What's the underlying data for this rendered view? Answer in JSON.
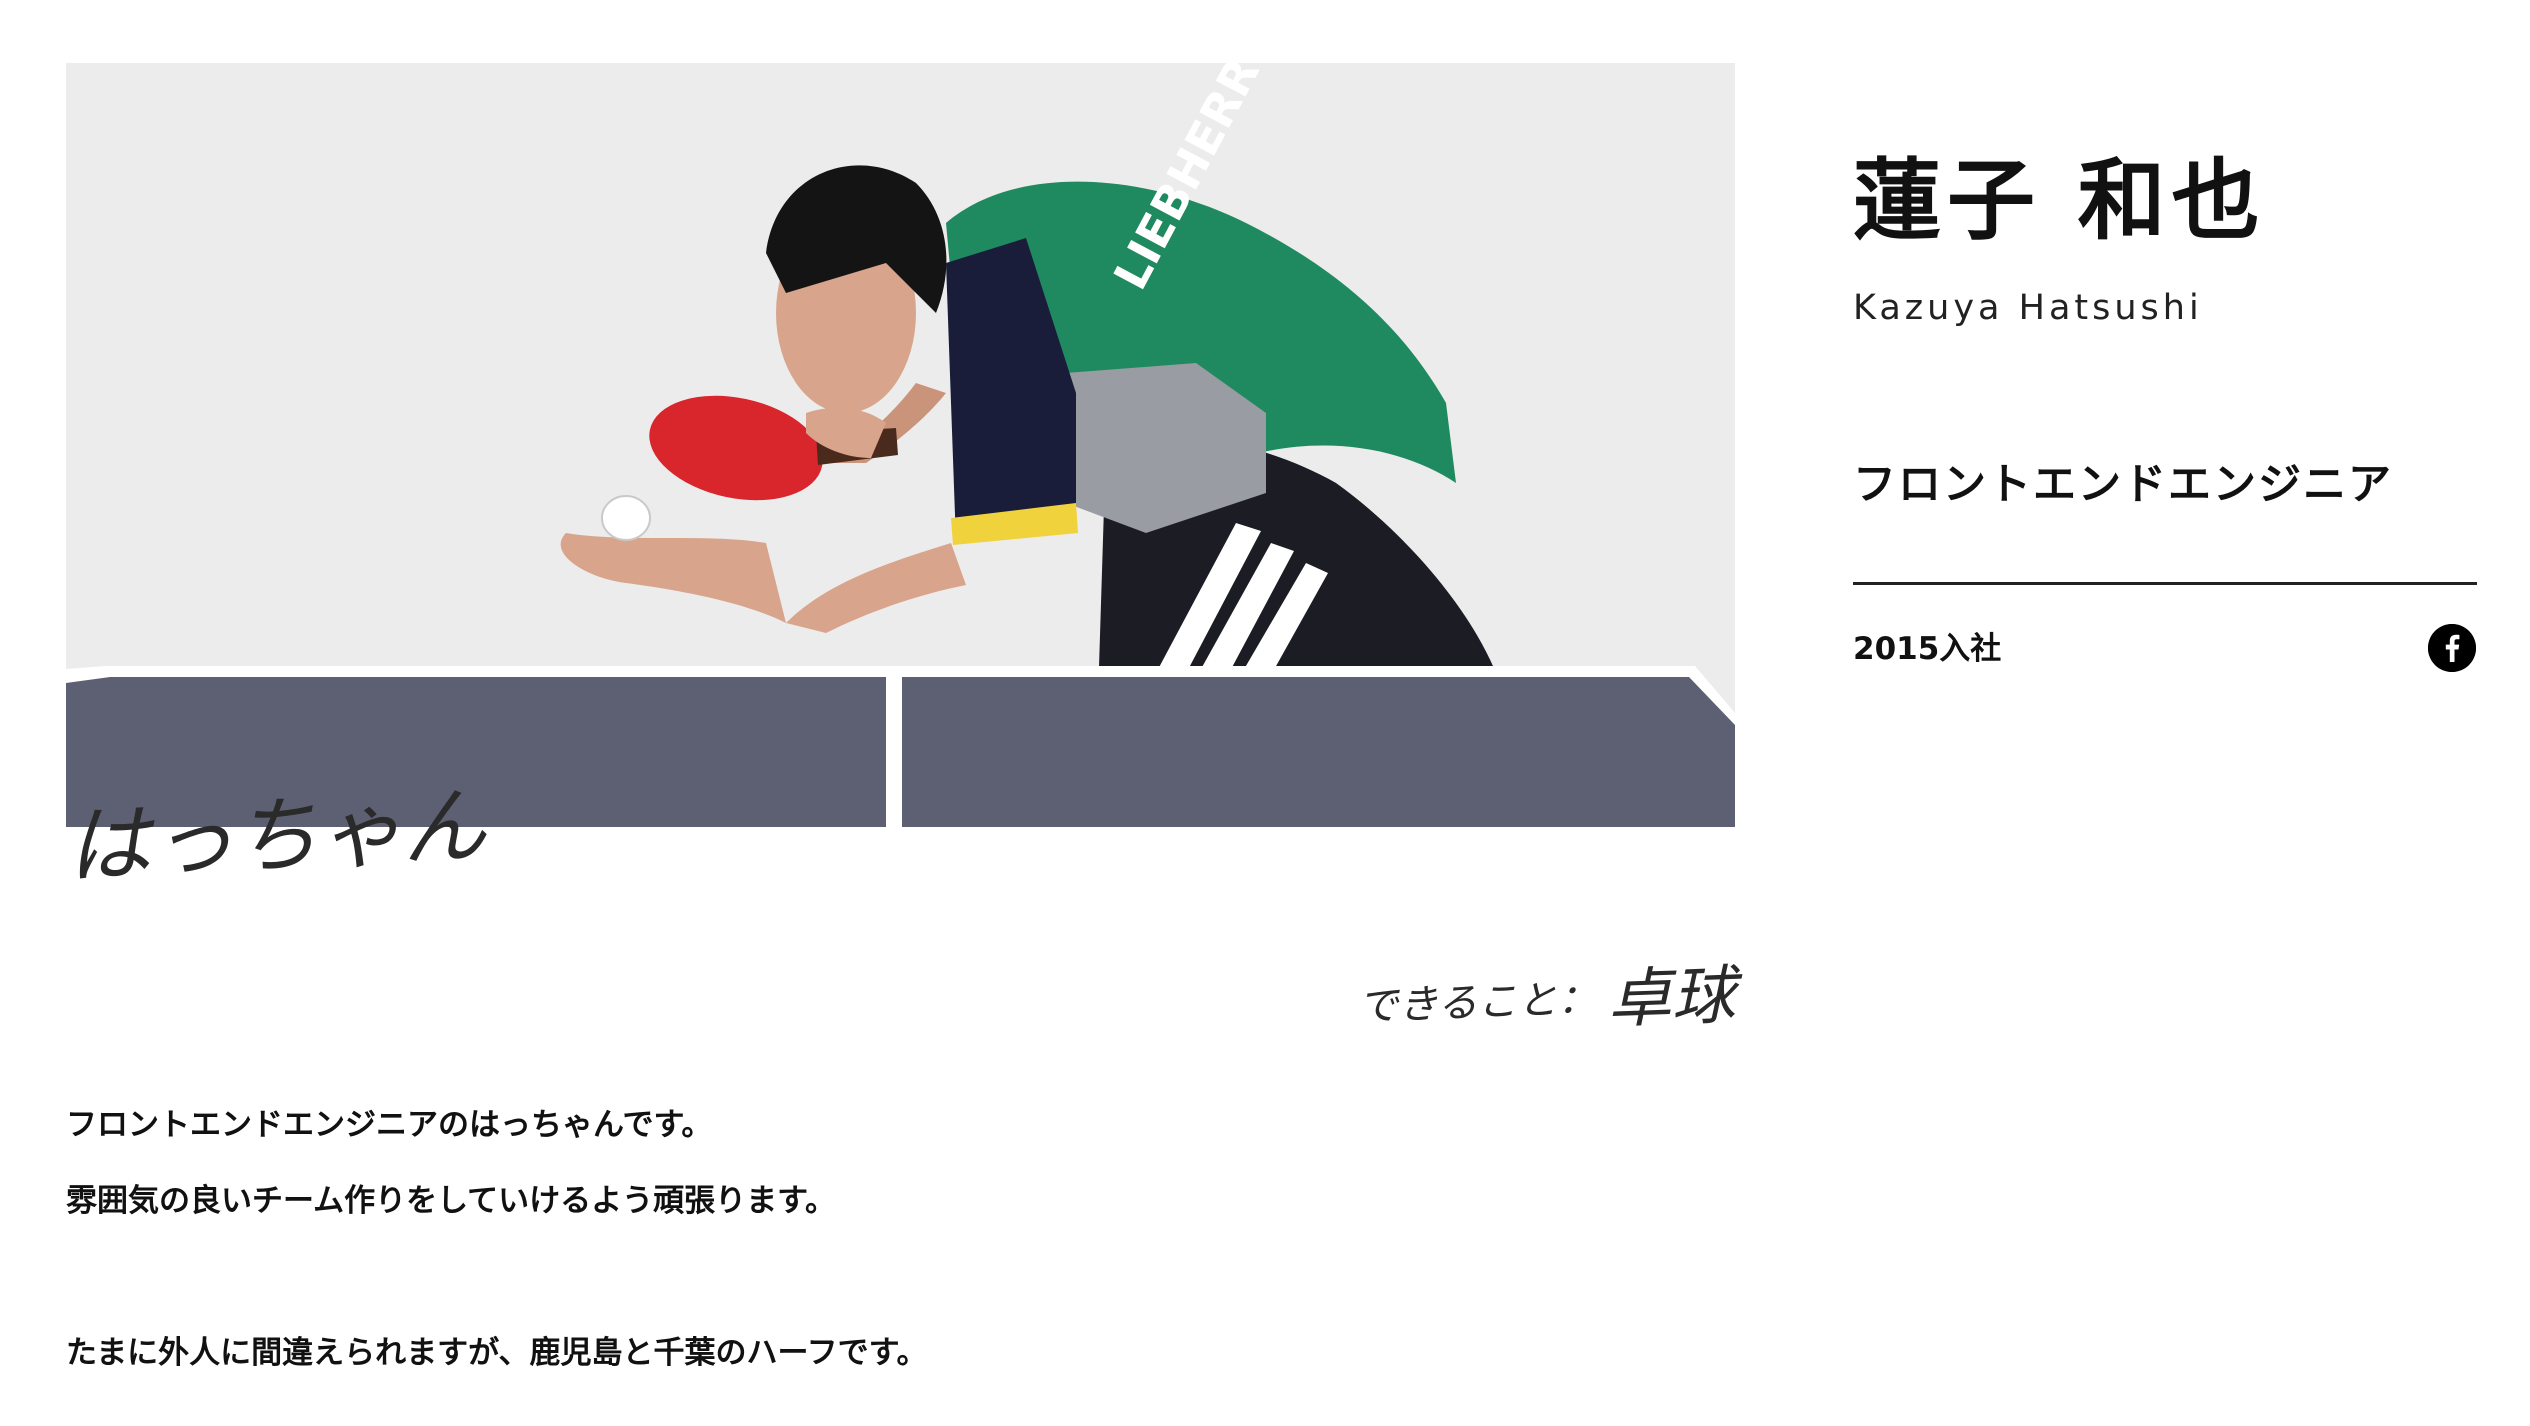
{
  "profile": {
    "name_ja": "蓮子 和也",
    "name_en": "Kazuya Hatsushi",
    "role": "フロントエンドエンジニア",
    "joined": "2015入社"
  },
  "photo": {
    "nickname": "はっちゃん",
    "skill_label": "できること：",
    "skill_value": "卓球",
    "jersey_text": "LIEBHERR"
  },
  "bio": {
    "paragraphs": [
      "フロントエンドエンジニアのはっちゃんです。",
      "雰囲気の良いチーム作りをしていけるよう頑張ります。",
      "たまに外人に間違えられますが、鹿児島と千葉のハーフです。"
    ]
  },
  "social": {
    "icon": "facebook-icon"
  },
  "colors": {
    "text": "#111111",
    "table": "#5d6072",
    "jersey": "#1f8a60",
    "paddle": "#d8262c",
    "facebook_icon": "#000000"
  }
}
